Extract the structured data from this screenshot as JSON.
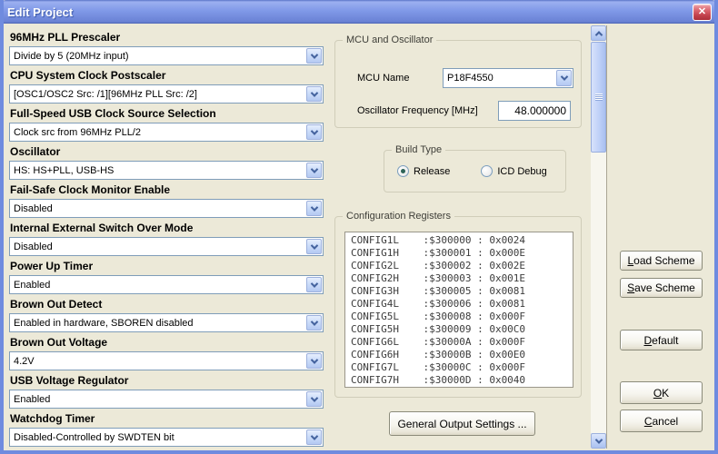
{
  "window": {
    "title": "Edit Project",
    "close_glyph": "✕"
  },
  "fields": [
    {
      "name": "pll-prescaler",
      "label": "96MHz PLL Prescaler",
      "value": "Divide by 5 (20MHz input)"
    },
    {
      "name": "cpu-clock-postscaler",
      "label": "CPU System Clock Postscaler",
      "value": "[OSC1/OSC2 Src: /1][96MHz PLL Src: /2]"
    },
    {
      "name": "usb-clock-source",
      "label": "Full-Speed USB Clock Source Selection",
      "value": "Clock src from 96MHz PLL/2"
    },
    {
      "name": "oscillator",
      "label": "Oscillator",
      "value": "HS: HS+PLL, USB-HS"
    },
    {
      "name": "fail-safe-clock-monitor",
      "label": "Fail-Safe Clock Monitor Enable",
      "value": "Disabled"
    },
    {
      "name": "int-ext-switch-over",
      "label": "Internal External Switch Over Mode",
      "value": "Disabled"
    },
    {
      "name": "power-up-timer",
      "label": "Power Up Timer",
      "value": "Enabled"
    },
    {
      "name": "brown-out-detect",
      "label": "Brown Out Detect",
      "value": "Enabled in hardware, SBOREN disabled"
    },
    {
      "name": "brown-out-voltage",
      "label": "Brown Out Voltage",
      "value": "4.2V"
    },
    {
      "name": "usb-voltage-regulator",
      "label": "USB Voltage Regulator",
      "value": "Enabled"
    },
    {
      "name": "watchdog-timer",
      "label": "Watchdog Timer",
      "value": "Disabled-Controlled by SWDTEN bit"
    }
  ],
  "mcu_group": {
    "title": "MCU and Oscillator",
    "mcu_name_label": "MCU Name",
    "mcu_name_value": "P18F4550",
    "osc_freq_label": "Oscillator Frequency [MHz]",
    "osc_freq_value": "48.000000"
  },
  "build_type": {
    "title": "Build Type",
    "options": [
      {
        "label": "Release",
        "selected": true
      },
      {
        "label": "ICD Debug",
        "selected": false
      }
    ]
  },
  "config_registers": {
    "title": "Configuration Registers",
    "rows": [
      "CONFIG1L    :$300000 : 0x0024",
      "CONFIG1H    :$300001 : 0x000E",
      "CONFIG2L    :$300002 : 0x002E",
      "CONFIG2H    :$300003 : 0x001E",
      "CONFIG3H    :$300005 : 0x0081",
      "CONFIG4L    :$300006 : 0x0081",
      "CONFIG5L    :$300008 : 0x000F",
      "CONFIG5H    :$300009 : 0x00C0",
      "CONFIG6L    :$30000A : 0x000F",
      "CONFIG6H    :$30000B : 0x00E0",
      "CONFIG7L    :$30000C : 0x000F",
      "CONFIG7H    :$30000D : 0x0040"
    ]
  },
  "buttons": {
    "general_output": "General Output Settings ...",
    "load_scheme": "Load Scheme",
    "save_scheme": "Save Scheme",
    "default": "Default",
    "ok": "OK",
    "cancel": "Cancel"
  },
  "colors": {
    "titlebar_blue": "#7b96e6",
    "window_border_blue": "#6f8bdf",
    "close_button_red": "#c3414c",
    "dialog_background": "#ece9d8",
    "field_border": "#7f9db9",
    "combo_arrow_blue": "#44639e",
    "radio_dot": "#2e6458"
  }
}
